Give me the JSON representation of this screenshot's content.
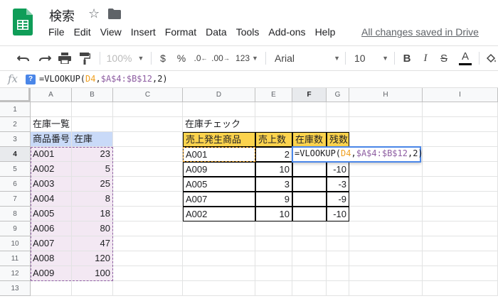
{
  "doc": {
    "title": "検索",
    "save_status": "All changes saved in Drive"
  },
  "menu": [
    "File",
    "Edit",
    "View",
    "Insert",
    "Format",
    "Data",
    "Tools",
    "Add-ons",
    "Help"
  ],
  "toolbar": {
    "zoom": "100%",
    "currency": "$",
    "percent": "%",
    "dec_less": ".0",
    "dec_more": ".00",
    "more_formats": "123",
    "font": "Arial",
    "font_size": "10",
    "bold": "B",
    "italic": "I",
    "strike": "S",
    "text_color": "A"
  },
  "formula_bar": {
    "fx": "fx",
    "help": "?",
    "prefix": "=VLOOKUP(",
    "ref1": "D4",
    "sep1": ",",
    "ref2": "$A$4:$B$12",
    "tail": ",2)"
  },
  "columns": [
    "A",
    "B",
    "C",
    "D",
    "E",
    "F",
    "G",
    "H",
    "I"
  ],
  "rows": [
    "1",
    "2",
    "3",
    "4",
    "5",
    "6",
    "7",
    "8",
    "9",
    "10",
    "11",
    "12",
    "13"
  ],
  "stock_list": {
    "title": "在庫一覧",
    "headers": [
      "商品番号",
      "在庫"
    ],
    "rows": [
      [
        "A001",
        "23"
      ],
      [
        "A002",
        "5"
      ],
      [
        "A003",
        "25"
      ],
      [
        "A004",
        "8"
      ],
      [
        "A005",
        "18"
      ],
      [
        "A006",
        "80"
      ],
      [
        "A007",
        "47"
      ],
      [
        "A008",
        "120"
      ],
      [
        "A009",
        "100"
      ]
    ]
  },
  "stock_check": {
    "title": "在庫チェック",
    "headers": [
      "売上発生商品",
      "売上数",
      "在庫数",
      "残数"
    ],
    "rows": [
      [
        "A001",
        "2",
        "",
        "",
        ""
      ],
      [
        "A009",
        "10",
        "",
        "-10"
      ],
      [
        "A005",
        "3",
        "",
        "-3"
      ],
      [
        "A007",
        "9",
        "",
        "-9"
      ],
      [
        "A002",
        "10",
        "",
        "-10"
      ]
    ]
  },
  "colors": {
    "blue_header": "#c9daf8",
    "yellow_header": "#fcd34d",
    "range": "#f3e8f3",
    "accent": "#4a86e8"
  }
}
